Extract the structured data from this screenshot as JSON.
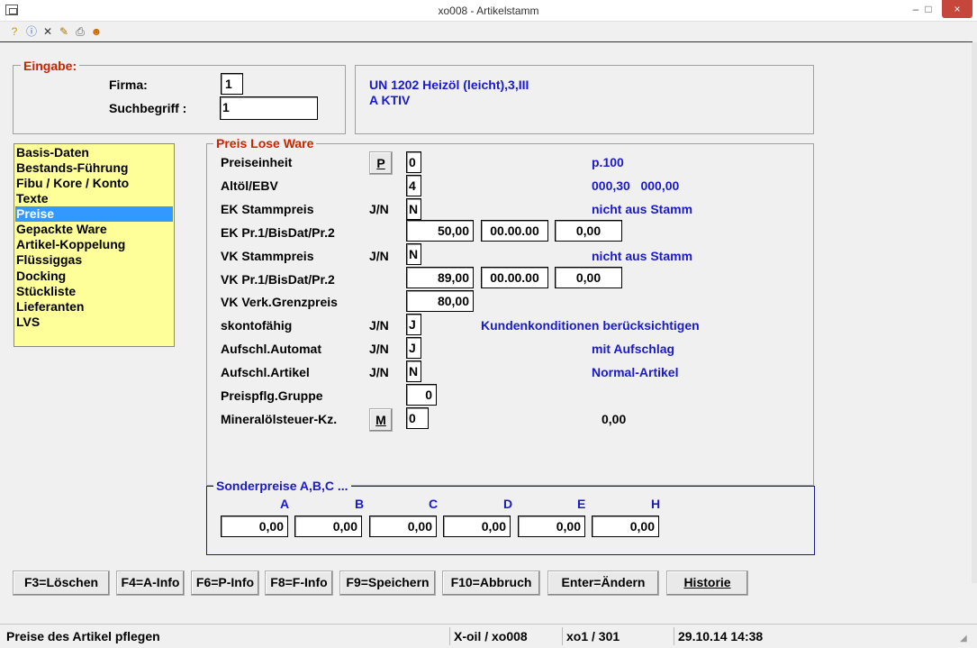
{
  "window": {
    "title": "xo008 - Artikelstamm",
    "minimize": "–",
    "maximize": "□",
    "close": "×"
  },
  "toolbar": {
    "icons": [
      "help-icon",
      "info-icon",
      "delete-icon",
      "edit-icon",
      "print-icon",
      "user-icon"
    ]
  },
  "eingabe": {
    "legend": "Eingabe:",
    "firma_label": "Firma:",
    "firma_value": "1",
    "suchbegriff_label": "Suchbegriff :",
    "suchbegriff_value": "1"
  },
  "info": {
    "line1": "UN 1202 Heizöl (leicht),3,III",
    "line2": "A  KTIV"
  },
  "menu": {
    "items": [
      "Basis-Daten",
      "Bestands-Führung",
      "Fibu / Kore / Konto",
      "Texte",
      "Preise",
      "Gepackte Ware",
      "Artikel-Koppelung",
      "Flüssiggas",
      "Docking",
      "Stückliste",
      "Lieferanten",
      "LVS"
    ],
    "selected": "Preise"
  },
  "preis": {
    "legend": "Preis Lose Ware",
    "rows": {
      "preiseinheit": {
        "label": "Preiseinheit",
        "button": "P",
        "value": "0",
        "info": "p.100"
      },
      "altoel": {
        "label": "Altöl/EBV",
        "value": "4",
        "info": "000,30   000,00"
      },
      "ek_stamm": {
        "label": "EK Stammpreis",
        "jn": "J/N",
        "value": "N",
        "info": "nicht aus Stamm"
      },
      "ek_pr": {
        "label": "EK Pr.1/BisDat/Pr.2",
        "v1": "50,00",
        "v2": "00.00.00",
        "v3": "0,00"
      },
      "vk_stamm": {
        "label": "VK Stammpreis",
        "jn": "J/N",
        "value": "N",
        "info": "nicht aus Stamm"
      },
      "vk_pr": {
        "label": "VK Pr.1/BisDat/Pr.2",
        "v1": "89,00",
        "v2": "00.00.00",
        "v3": "0,00"
      },
      "vk_grenz": {
        "label": "VK Verk.Grenzpreis",
        "value": "80,00"
      },
      "skonto": {
        "label": "skontofähig",
        "jn": "J/N",
        "value": "J",
        "info": "Kundenkonditionen berücksichtigen"
      },
      "aufschl_auto": {
        "label": "Aufschl.Automat",
        "jn": "J/N",
        "value": "J",
        "info": "mit Aufschlag"
      },
      "aufschl_art": {
        "label": "Aufschl.Artikel",
        "jn": "J/N",
        "value": "N",
        "info": "Normal-Artikel"
      },
      "preispfl": {
        "label": "Preispflg.Gruppe",
        "value": "0"
      },
      "mineral": {
        "label": "Mineralölsteuer-Kz.",
        "button": "M",
        "value": "0",
        "info": "0,00"
      }
    }
  },
  "sonder": {
    "legend": "Sonderpreise A,B,C ...",
    "cols": [
      {
        "h": "A",
        "v": "0,00"
      },
      {
        "h": "B",
        "v": "0,00"
      },
      {
        "h": "C",
        "v": "0,00"
      },
      {
        "h": "D",
        "v": "0,00"
      },
      {
        "h": "E",
        "v": "0,00"
      },
      {
        "h": "H",
        "v": "0,00"
      }
    ]
  },
  "buttons": {
    "f3": "F3=Löschen",
    "f4": "F4=A-Info",
    "f6": "F6=P-Info",
    "f8": "F8=F-Info",
    "f9": "F9=Speichern",
    "f10": "F10=Abbruch",
    "enter": "Enter=Ändern",
    "historie": "Historie"
  },
  "status": {
    "message": "Preise des Artikel pflegen",
    "app": "X-oil / xo008",
    "user": "xo1 / 301",
    "datetime": "29.10.14 14:38"
  }
}
